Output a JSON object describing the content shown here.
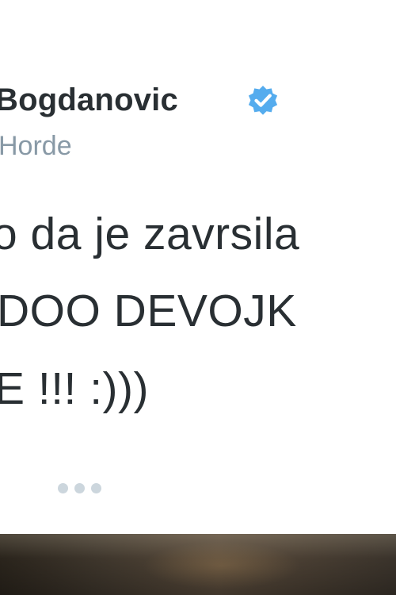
{
  "tweet": {
    "display_name": "Bogdanovic",
    "handle": "Horde",
    "verified_icon": "verified-badge-icon",
    "text_lines": [
      "o da je zavrsila",
      "DOO DEVOJK",
      "E !!! :)))"
    ],
    "more_icon": "more-dots-icon"
  },
  "colors": {
    "text": "#292f33",
    "secondary_text": "#8899a6",
    "verified_blue": "#55acee",
    "more_dots": "#ccd6dd",
    "background": "#ffffff"
  }
}
